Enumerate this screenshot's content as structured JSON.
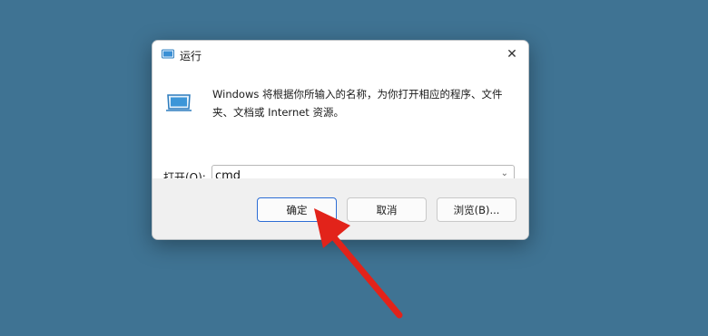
{
  "dialog": {
    "title": "运行",
    "close_glyph": "✕",
    "description": "Windows 将根据你所输入的名称，为你打开相应的程序、文件夹、文档或 Internet 资源。",
    "open_label": "打开(O):",
    "input_value": "cmd",
    "dropdown_glyph": "⌄",
    "buttons": {
      "ok": "确定",
      "cancel": "取消",
      "browse": "浏览(B)..."
    }
  },
  "icons": {
    "title_icon": "run-dialog-icon",
    "body_icon": "run-dialog-icon",
    "close_icon": "close-icon",
    "dropdown_icon": "chevron-down-icon"
  },
  "colors": {
    "desktop": "#3f7393",
    "accent": "#0a64c8",
    "annotation_arrow": "#e2231a"
  }
}
